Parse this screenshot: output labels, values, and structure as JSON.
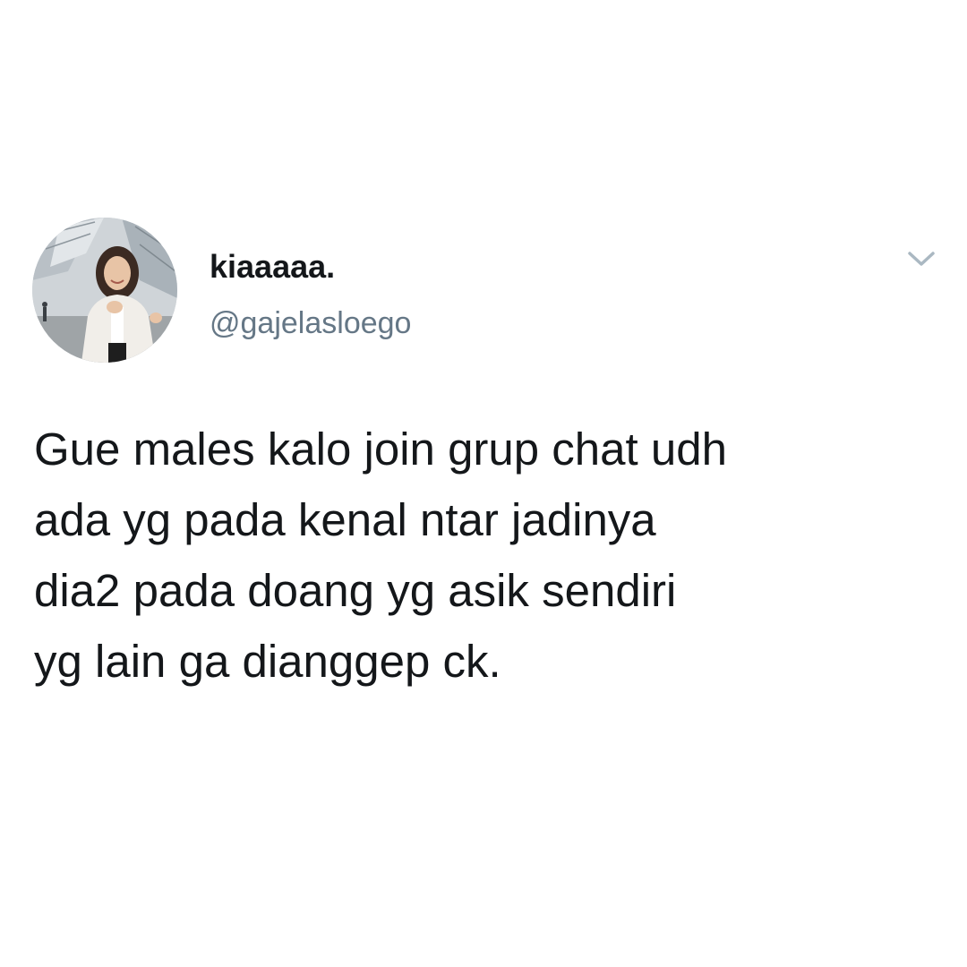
{
  "tweet": {
    "author": {
      "display_name": "kiaaaaa.",
      "handle": "@gajelasloego",
      "avatar_icon": "profile-photo"
    },
    "menu_icon": "chevron-down-icon",
    "text_lines": [
      "Gue males kalo join grup chat udh",
      "ada yg pada kenal ntar jadinya",
      "dia2 pada doang yg asik sendiri",
      "yg lain ga dianggep ck."
    ]
  },
  "colors": {
    "background": "#ffffff",
    "text_primary": "#14171a",
    "text_secondary": "#657786",
    "chevron": "#aab8c2"
  }
}
